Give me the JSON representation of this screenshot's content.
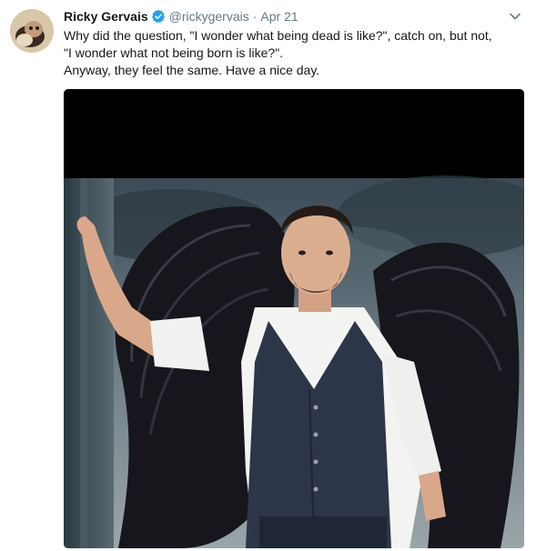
{
  "tweet": {
    "author_name": "Ricky Gervais",
    "handle": "@rickygervais",
    "separator": "·",
    "date": "Apr 21",
    "text_lines": [
      "Why did the question, \"I wonder what being dead is like?\", catch on, but not,",
      "\"I wonder what not being born is like?\".",
      "Anyway, they feel the same. Have a nice day."
    ],
    "icons": {
      "verified": "verified-badge-icon",
      "menu": "chevron-down-icon"
    },
    "colors": {
      "accent": "#1da1f2",
      "secondary_text": "#657786",
      "primary_text": "#14171a"
    }
  }
}
